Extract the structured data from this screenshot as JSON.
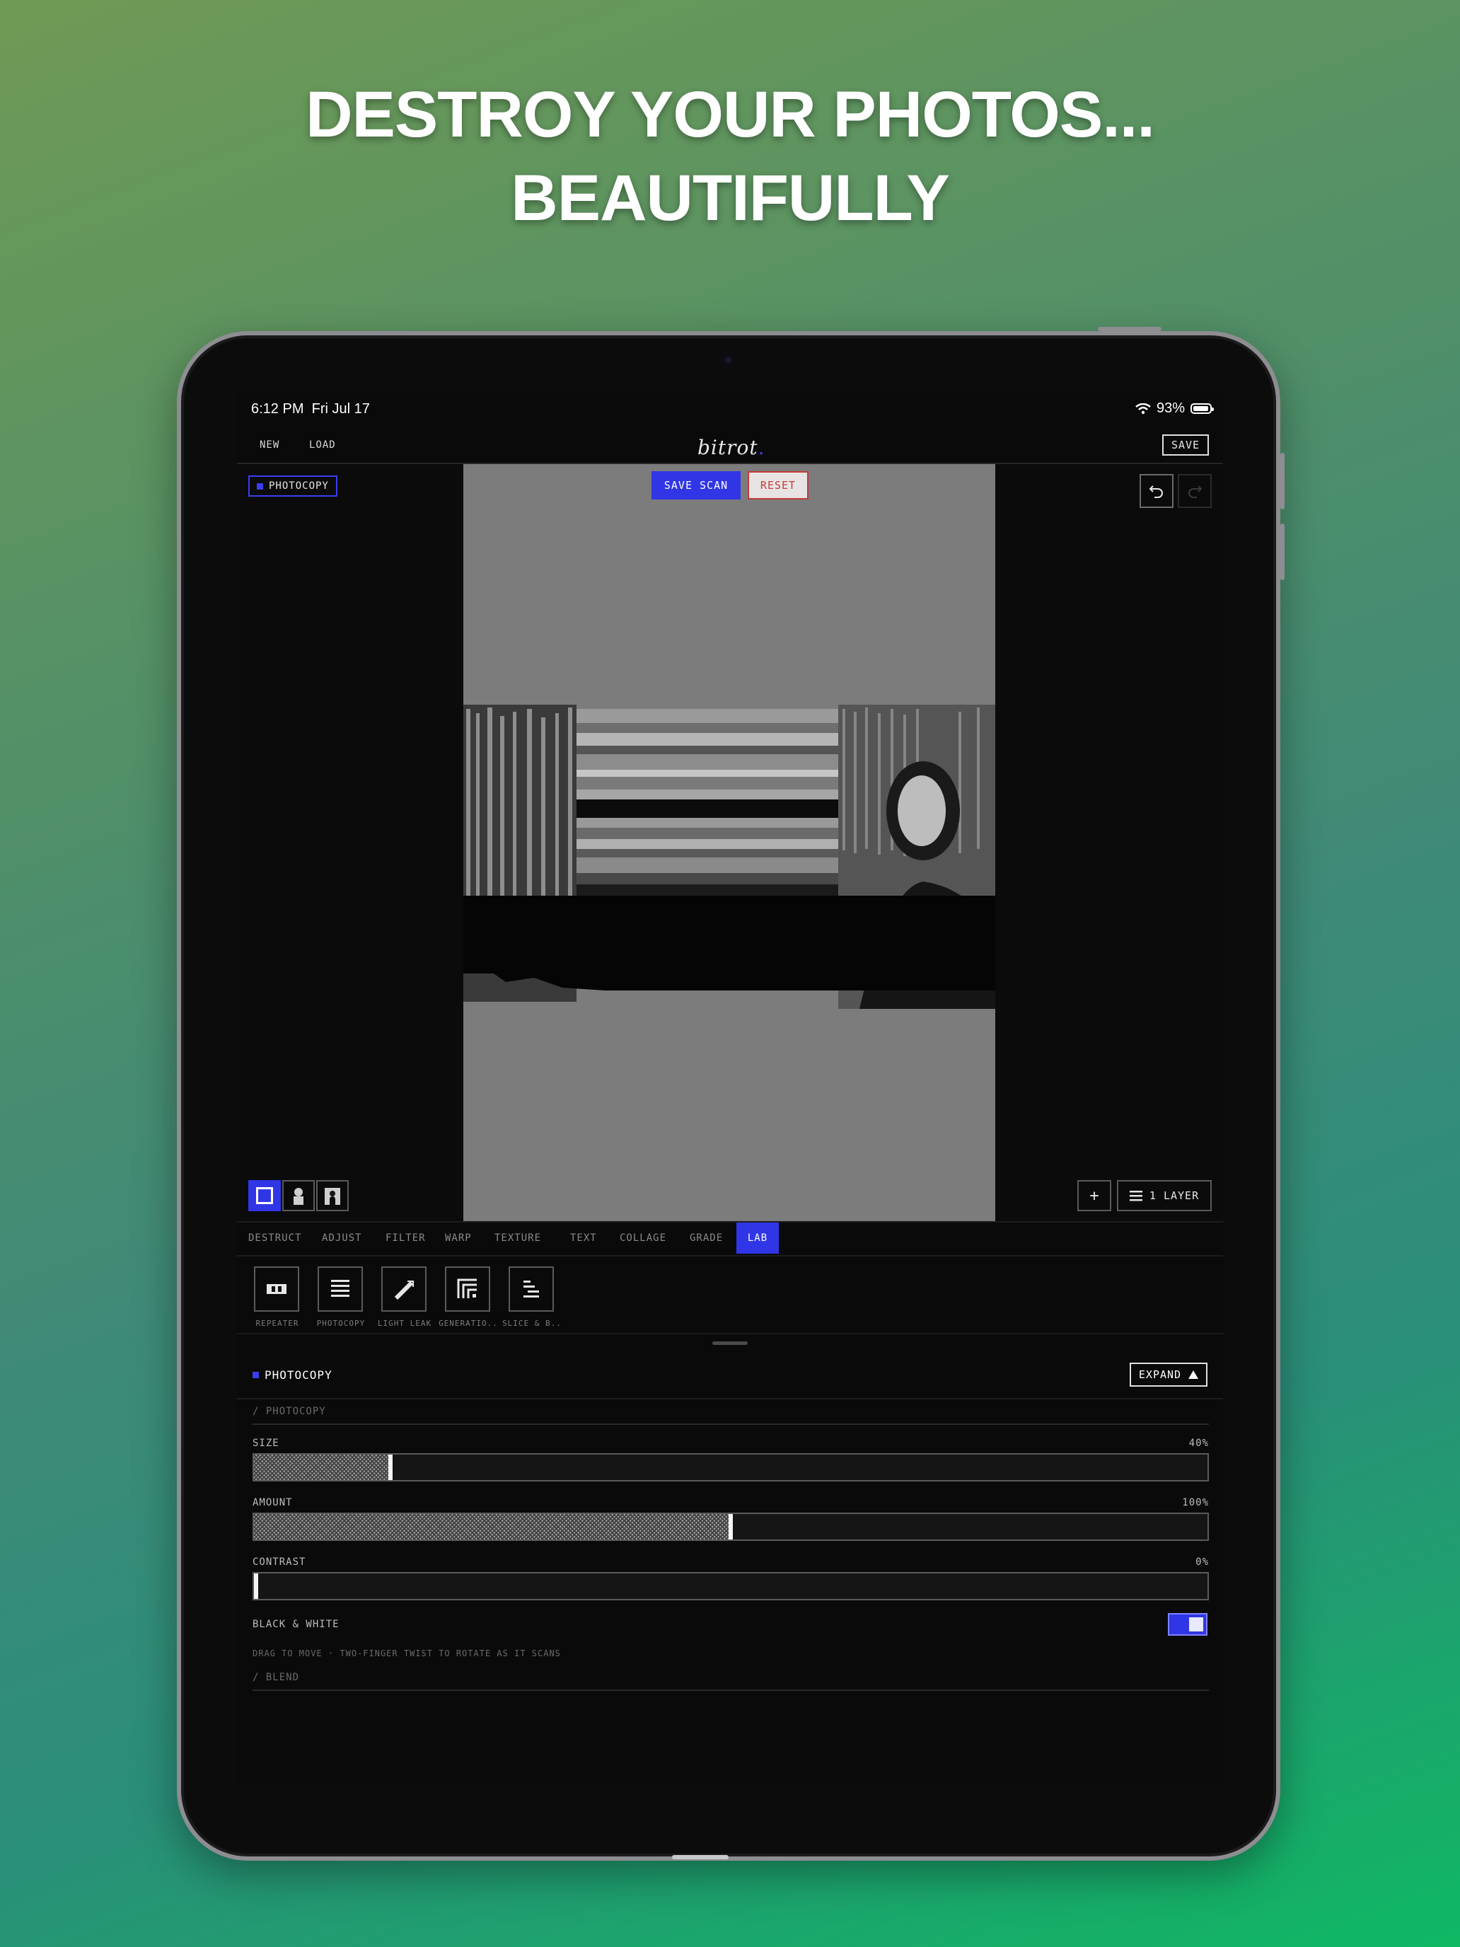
{
  "headline": {
    "line1": "DESTROY YOUR PHOTOS...",
    "line2": "BEAUTIFULLY"
  },
  "status_bar": {
    "time": "6:12 PM",
    "date": "Fri Jul 17",
    "battery": "93%",
    "icons": [
      "wifi-icon",
      "battery-icon"
    ]
  },
  "topbar": {
    "new_label": "NEW",
    "load_label": "LOAD",
    "logo": "bitrot",
    "logo_dot": ".",
    "save_label": "SAVE"
  },
  "canvas": {
    "layer_tag": "PHOTOCOPY",
    "save_scan_label": "SAVE SCAN",
    "reset_label": "RESET",
    "layers_label": "1 LAYER",
    "add_icon": "+",
    "mask_icons": [
      "square-mask-icon",
      "person-mask-icon",
      "head-mask-icon"
    ],
    "history_icons": [
      "undo-icon",
      "redo-icon"
    ]
  },
  "tabs": [
    "DESTRUCT",
    "ADJUST",
    "FILTER",
    "WARP",
    "TEXTURE",
    "TEXT",
    "COLLAGE",
    "GRADE",
    "LAB"
  ],
  "active_tab": "LAB",
  "tools": [
    {
      "label": "REPEATER",
      "icon": "repeater-icon"
    },
    {
      "label": "PHOTOCOPY",
      "icon": "photocopy-icon"
    },
    {
      "label": "LIGHT LEAK",
      "icon": "light-leak-icon"
    },
    {
      "label": "GENERATIO..",
      "icon": "generation-icon"
    },
    {
      "label": "SLICE & B..",
      "icon": "slice-icon"
    }
  ],
  "panel": {
    "title": "PHOTOCOPY",
    "expand_label": "EXPAND",
    "section_photocopy": "/  PHOTOCOPY",
    "section_blend": "/  BLEND",
    "sliders": [
      {
        "label": "SIZE",
        "value_text": "40%",
        "fraction": 0.143
      },
      {
        "label": "AMOUNT",
        "value_text": "100%",
        "fraction": 0.5
      },
      {
        "label": "CONTRAST",
        "value_text": "0%",
        "fraction": 0.0
      }
    ],
    "toggle": {
      "label": "BLACK & WHITE",
      "on": true
    },
    "hint": "DRAG TO MOVE · TWO-FINGER TWIST TO ROTATE AS IT SCANS"
  },
  "colors": {
    "accent": "#3036e6",
    "reset": "#c53b3b",
    "screen_bg": "#0a0a0a"
  }
}
